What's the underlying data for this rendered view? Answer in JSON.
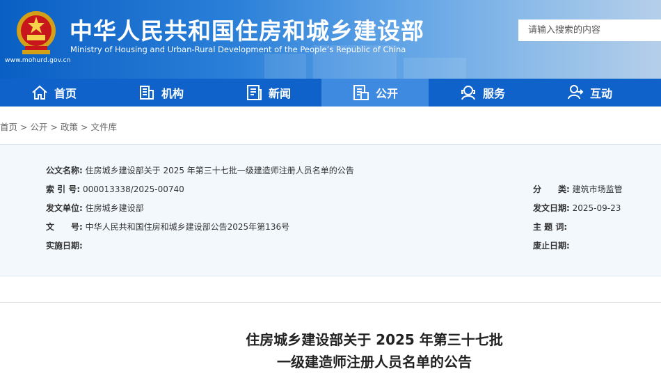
{
  "header": {
    "title_cn": "中华人民共和国住房和城乡建设部",
    "title_en": "Ministry of Housing and Urban-Rural Development of the People’s Republic of China",
    "site_url": "www.mohurd.gov.cn",
    "search_placeholder": "请输入搜索的内容",
    "colors": {
      "banner": "#0a5fc4",
      "nav": "#0e62c9",
      "nav_active": "#3d8ae0"
    }
  },
  "nav": {
    "items": [
      {
        "label": "首页",
        "icon": "home-icon"
      },
      {
        "label": "机构",
        "icon": "building-icon"
      },
      {
        "label": "新闻",
        "icon": "news-icon"
      },
      {
        "label": "公开",
        "icon": "document-icon",
        "active": true
      },
      {
        "label": "服务",
        "icon": "service-icon"
      },
      {
        "label": "互动",
        "icon": "interact-icon"
      }
    ]
  },
  "breadcrumb": {
    "items": [
      "首页",
      "公开",
      "政策",
      "文件库"
    ],
    "separator": ">"
  },
  "info": {
    "name_label": "公文名称:",
    "name_value": "住房城乡建设部关于 2025 年第三十七批一级建造师注册人员名单的公告",
    "index_label": "索 引 号:",
    "index_value": "000013338/2025-00740",
    "category_label": "分　　类:",
    "category_value": "建筑市场监管",
    "issuer_label": "发文单位:",
    "issuer_value": "住房城乡建设部",
    "date_label": "发文日期:",
    "date_value": "2025-09-23",
    "docno_label": "文　　号:",
    "docno_value": "中华人民共和国住房和城乡建设部公告2025年第136号",
    "subject_label": "主 题 词:",
    "subject_value": "",
    "effective_label": "实施日期:",
    "effective_value": "",
    "repeal_label": "废止日期:",
    "repeal_value": ""
  },
  "document": {
    "title_line1": "住房城乡建设部关于 2025 年第三十七批",
    "title_line2": "一级建造师注册人员名单的公告"
  }
}
